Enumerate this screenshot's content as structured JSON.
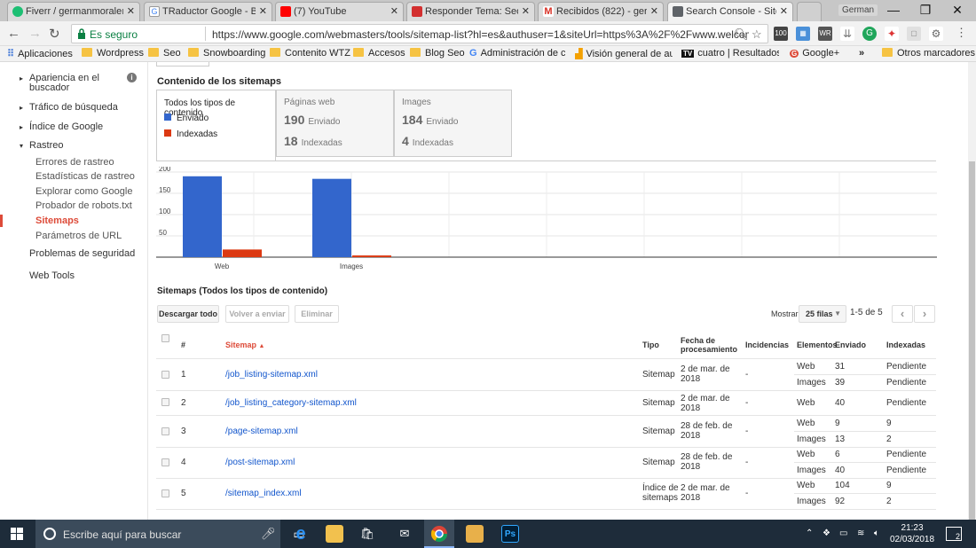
{
  "browser": {
    "tabs": [
      {
        "label": "Fiverr / germanmoraleı",
        "icon": "fiverr-icon",
        "color": "#1dbf73"
      },
      {
        "label": "TRaductor Google - Bu",
        "icon": "google-icon",
        "color": "#4285f4"
      },
      {
        "label": "(7) YouTube",
        "icon": "youtube-icon",
        "color": "#ff0000"
      },
      {
        "label": "Responder Tema: Seo p",
        "icon": "forum-icon",
        "color": "#d32f2f"
      },
      {
        "label": "Recibidos (822) - germ",
        "icon": "gmail-icon",
        "color": "#d93025"
      },
      {
        "label": "Search Console - Siter",
        "icon": "search-console-icon",
        "color": "#5f6368"
      }
    ],
    "profile_name": "German",
    "secure_label": "Es seguro",
    "url": "https://www.google.com/webmasters/tools/sitemap-list?hl=es&authuser=1&siteUrl=https%3A%2F%2Fwww.welcometozillertal.at%...",
    "bookmarks": [
      {
        "label": "Aplicaciones",
        "icon": "apps-icon"
      },
      {
        "label": "Wordpress",
        "icon": "folder-icon"
      },
      {
        "label": "Seo",
        "icon": "folder-icon"
      },
      {
        "label": "Snowboarding",
        "icon": "folder-icon"
      },
      {
        "label": "Contenito WTZ",
        "icon": "folder-icon"
      },
      {
        "label": "Accesos",
        "icon": "folder-icon"
      },
      {
        "label": "Blog Seo",
        "icon": "folder-icon"
      },
      {
        "label": "Administración de ca",
        "icon": "google-icon"
      },
      {
        "label": "Visión general de auc",
        "icon": "analytics-icon"
      },
      {
        "label": "cuatro | Resultados d",
        "icon": "tv-icon"
      },
      {
        "label": "Google+",
        "icon": "googleplus-icon"
      },
      {
        "label": "»",
        "icon": ""
      },
      {
        "label": "Otros marcadores",
        "icon": "folder-icon"
      }
    ]
  },
  "sidebar": {
    "items": [
      {
        "label": "Apariencia en el buscador",
        "type": "collapsed"
      },
      {
        "label": "Tráfico de búsqueda",
        "type": "collapsed"
      },
      {
        "label": "Índice de Google",
        "type": "collapsed"
      },
      {
        "label": "Rastreo",
        "type": "expanded"
      },
      {
        "label": "Errores de rastreo",
        "type": "sub"
      },
      {
        "label": "Estadísticas de rastreo",
        "type": "sub"
      },
      {
        "label": "Explorar como Google",
        "type": "sub"
      },
      {
        "label": "Probador de robots.txt",
        "type": "sub"
      },
      {
        "label": "Sitemaps",
        "type": "sub-active"
      },
      {
        "label": "Parámetros de URL",
        "type": "sub"
      },
      {
        "label": "Problemas de seguridad",
        "type": "plain"
      },
      {
        "label": "Web Tools",
        "type": "plain"
      }
    ]
  },
  "content_section": {
    "title": "Contenido de los sitemaps",
    "all_types": {
      "title": "Todos los tipos de contenido",
      "legend": [
        "Enviado",
        "Indexadas"
      ]
    },
    "web_pages": {
      "title": "Páginas web",
      "submitted": "190",
      "submitted_label": "Enviado",
      "indexed": "18",
      "indexed_label": "Indexadas"
    },
    "images": {
      "title": "Images",
      "submitted": "184",
      "submitted_label": "Enviado",
      "indexed": "4",
      "indexed_label": "Indexadas"
    }
  },
  "chart_data": {
    "type": "bar",
    "categories": [
      "Web",
      "Images"
    ],
    "series": [
      {
        "name": "Enviado",
        "values": [
          190,
          184
        ],
        "color": "#3366cc"
      },
      {
        "name": "Indexadas",
        "values": [
          18,
          4
        ],
        "color": "#dc3912"
      }
    ],
    "ytick_labels": [
      "200",
      "150",
      "100",
      "50"
    ],
    "ylim": [
      0,
      200
    ],
    "grid": true,
    "legend": "top-left"
  },
  "table_section": {
    "title": "Sitemaps (Todos los tipos de contenido)",
    "buttons": {
      "download": "Descargar todo",
      "resubmit": "Volver a enviar",
      "delete": "Eliminar"
    },
    "show_label": "Mostrar",
    "rows_select": "25 filas",
    "pagination": "1-5 de 5",
    "headers": {
      "num": "#",
      "sitemap": "Sitemap",
      "tipo": "Tipo",
      "fecha": "Fecha de procesamiento",
      "incidencias": "Incidencias",
      "elementos": "Elementos",
      "enviado": "Enviado",
      "indexadas": "Indexadas"
    },
    "rows": [
      {
        "num": "1",
        "path": "/job_listing-sitemap.xml",
        "type": "Sitemap",
        "date": "2 de mar. de 2018",
        "issues": "-",
        "items": [
          {
            "kind": "Web",
            "sent": "31",
            "indexed": "Pendiente"
          },
          {
            "kind": "Images",
            "sent": "39",
            "indexed": "Pendiente"
          }
        ]
      },
      {
        "num": "2",
        "path": "/job_listing_category-sitemap.xml",
        "type": "Sitemap",
        "date": "2 de mar. de 2018",
        "issues": "-",
        "items": [
          {
            "kind": "Web",
            "sent": "40",
            "indexed": "Pendiente"
          }
        ]
      },
      {
        "num": "3",
        "path": "/page-sitemap.xml",
        "type": "Sitemap",
        "date": "28 de feb. de 2018",
        "issues": "-",
        "items": [
          {
            "kind": "Web",
            "sent": "9",
            "indexed": "9"
          },
          {
            "kind": "Images",
            "sent": "13",
            "indexed": "2"
          }
        ]
      },
      {
        "num": "4",
        "path": "/post-sitemap.xml",
        "type": "Sitemap",
        "date": "28 de feb. de 2018",
        "issues": "-",
        "items": [
          {
            "kind": "Web",
            "sent": "6",
            "indexed": "Pendiente"
          },
          {
            "kind": "Images",
            "sent": "40",
            "indexed": "Pendiente"
          }
        ]
      },
      {
        "num": "5",
        "path": "/sitemap_index.xml",
        "type": "Índice de sitemaps",
        "date": "2 de mar. de 2018",
        "issues": "-",
        "items": [
          {
            "kind": "Web",
            "sent": "104",
            "indexed": "9"
          },
          {
            "kind": "Images",
            "sent": "92",
            "indexed": "2"
          }
        ]
      }
    ]
  },
  "taskbar": {
    "search_placeholder": "Escribe aquí para buscar",
    "time": "21:23",
    "date": "02/03/2018",
    "notifications": "2"
  }
}
